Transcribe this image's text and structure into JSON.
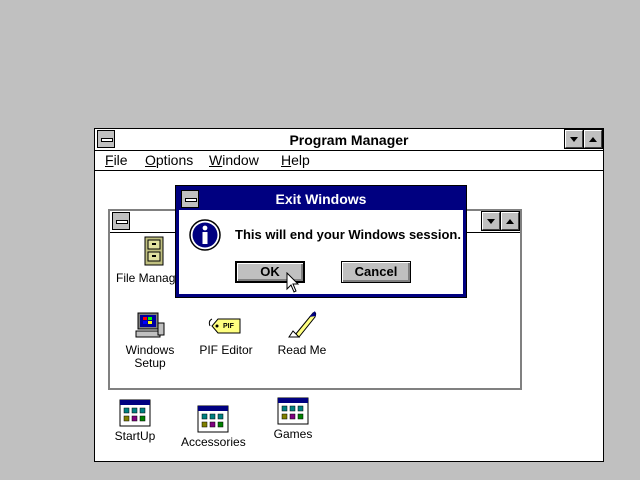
{
  "program_manager": {
    "title": "Program Manager",
    "menu": [
      {
        "label": "File",
        "accel": "F",
        "rest": "ile"
      },
      {
        "label": "Options",
        "accel": "O",
        "rest": "ptions"
      },
      {
        "label": "Window",
        "accel": "W",
        "rest": "indow"
      },
      {
        "label": "Help",
        "accel": "H",
        "rest": "elp"
      }
    ]
  },
  "group_window": {
    "title": "",
    "icons": [
      {
        "label": "File Manage",
        "icon": "file-cabinet-icon"
      },
      {
        "label": "Windows Setup",
        "line1": "Windows",
        "line2": "Setup",
        "icon": "windows-setup-icon"
      },
      {
        "label": "PIF Editor",
        "icon": "pif-tag-icon"
      },
      {
        "label": "Read Me",
        "icon": "quill-pen-icon"
      }
    ]
  },
  "group_icons": [
    {
      "label": "StartUp",
      "icon": "program-group-icon"
    },
    {
      "label": "Accessories",
      "icon": "program-group-icon"
    },
    {
      "label": "Games",
      "icon": "program-group-icon"
    }
  ],
  "dialog": {
    "title": "Exit Windows",
    "message": "This will end your Windows session.",
    "icon": "info-icon",
    "ok_label": "OK",
    "cancel_label": "Cancel"
  },
  "colors": {
    "desktop": "#c0c0c0",
    "active_title": "#000080",
    "button_face": "#c0c0c0"
  }
}
